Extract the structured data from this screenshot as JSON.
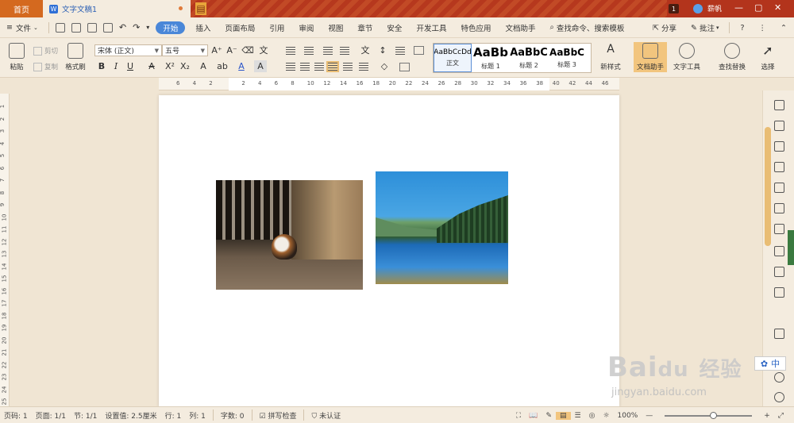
{
  "titlebar": {
    "home_tab": "首页",
    "doc_tab": "文字文稿1",
    "doc_icon": "W",
    "notification_count": "1",
    "user_name": "薪帆",
    "controls": [
      "—",
      "▢",
      "✕"
    ]
  },
  "menu": {
    "file_label": "文件",
    "tabs": [
      "开始",
      "插入",
      "页面布局",
      "引用",
      "审阅",
      "视图",
      "章节",
      "安全",
      "开发工具",
      "特色应用",
      "文档助手"
    ],
    "active_tab": "开始",
    "search_label": "查找命令、搜索模板",
    "share_label": "分享",
    "comment_label": "批注",
    "help_icon": "?"
  },
  "ribbon": {
    "paste_label": "粘贴",
    "cut_label": "剪切",
    "copy_label": "复制",
    "format_painter_label": "格式刷",
    "font_name": "宋体 (正文)",
    "font_size": "五号",
    "bold": "B",
    "italic": "I",
    "underline": "U",
    "styles": [
      {
        "preview": "AaBbCcDd",
        "name": "正文"
      },
      {
        "preview": "AaBb",
        "name": "标题 1"
      },
      {
        "preview": "AaBbC",
        "name": "标题 2"
      },
      {
        "preview": "AaBbC",
        "name": "标题 3"
      }
    ],
    "new_style_label": "新样式",
    "doc_helper_label": "文档助手",
    "text_tools_label": "文字工具",
    "find_replace_label": "查找替换",
    "select_label": "选择"
  },
  "ruler": {
    "ticks": [
      "6",
      "4",
      "2",
      "",
      "2",
      "4",
      "6",
      "8",
      "10",
      "12",
      "14",
      "16",
      "18",
      "20",
      "22",
      "24",
      "26",
      "28",
      "30",
      "32",
      "34",
      "36",
      "38",
      "40",
      "42",
      "44",
      "46"
    ]
  },
  "vruler": {
    "ticks": [
      "1",
      "2",
      "3",
      "4",
      "5",
      "6",
      "7",
      "8",
      "9",
      "10",
      "11",
      "12",
      "13",
      "14",
      "15",
      "16",
      "17",
      "18",
      "19",
      "20",
      "21",
      "22",
      "23",
      "24",
      "25"
    ]
  },
  "watermark": {
    "brand": "Bai",
    "brand_cn": "经验",
    "url": "jingyan.baidu.com"
  },
  "ime_label": "中",
  "status": {
    "page_num": "页码: 1",
    "pages": "页面: 1/1",
    "section": "节: 1/1",
    "setting": "设置值: 2.5厘米",
    "row": "行: 1",
    "col": "列: 1",
    "words": "字数: 0",
    "spell": "拼写检查",
    "cert": "未认证",
    "zoom": "100%",
    "zoom_level": 0.55
  }
}
